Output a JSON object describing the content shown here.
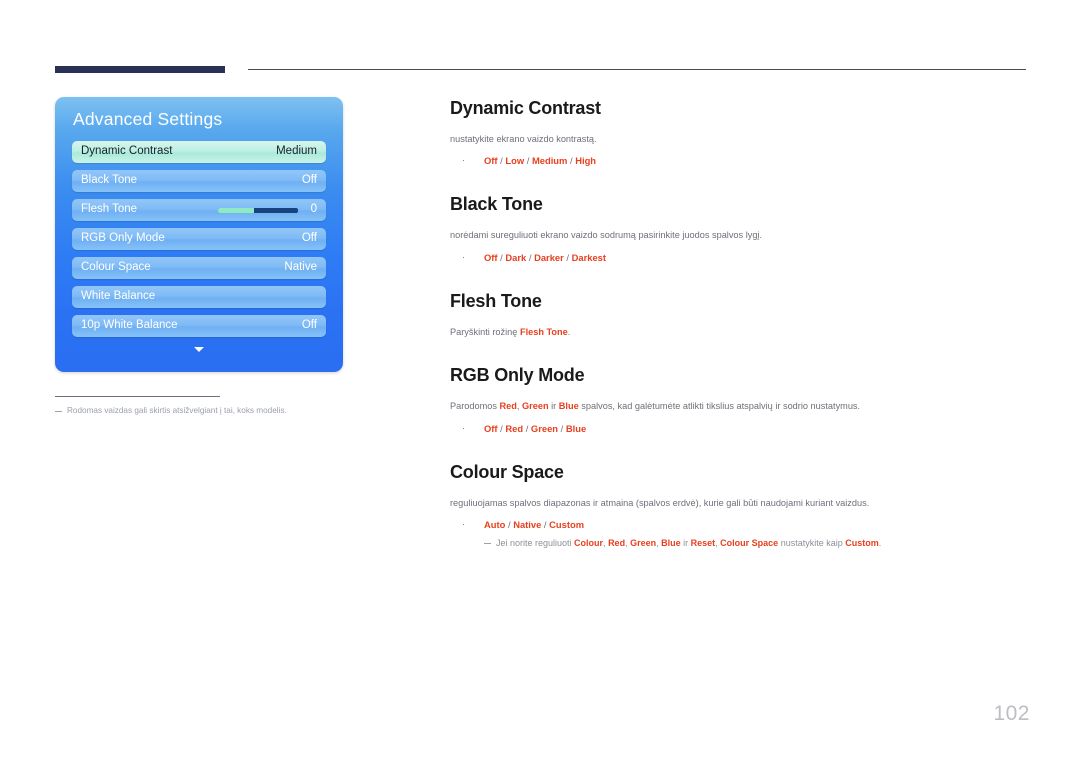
{
  "page": {
    "number": "102"
  },
  "osd": {
    "title": "Advanced Settings",
    "scroll_arrow_icon": "chevron-down-icon",
    "rows": [
      {
        "label": "Dynamic Contrast",
        "value": "Medium",
        "selected": true,
        "type": "value"
      },
      {
        "label": "Black Tone",
        "value": "Off",
        "selected": false,
        "type": "value"
      },
      {
        "label": "Flesh Tone",
        "value": "0",
        "selected": false,
        "type": "slider",
        "slider_percent": 45
      },
      {
        "label": "RGB Only Mode",
        "value": "Off",
        "selected": false,
        "type": "value"
      },
      {
        "label": "Colour Space",
        "value": "Native",
        "selected": false,
        "type": "value"
      },
      {
        "label": "White Balance",
        "value": "",
        "selected": false,
        "type": "value"
      },
      {
        "label": "10p White Balance",
        "value": "Off",
        "selected": false,
        "type": "value"
      }
    ]
  },
  "panel_footnote": {
    "text": "Rodomas vaizdas gali skirtis atsižvelgiant į tai, koks modelis."
  },
  "sections": {
    "dynamic_contrast": {
      "heading": "Dynamic Contrast",
      "desc": "nustatykite ekrano vaizdo kontrastą.",
      "bullet": "Off / Low / Medium / High"
    },
    "black_tone": {
      "heading": "Black Tone",
      "desc": "norėdami sureguliuoti ekrano vaizdo sodrumą pasirinkite juodos spalvos lygį.",
      "bullet": "Off / Dark / Darker / Darkest"
    },
    "flesh_tone": {
      "heading": "Flesh Tone",
      "desc_pre": "Paryškinti rožinę ",
      "desc_accent": "Flesh Tone",
      "desc_post": "."
    },
    "rgb_only_mode": {
      "heading": "RGB Only Mode",
      "desc_p1": "Parodomos ",
      "desc_a1": "Red",
      "desc_p2": ", ",
      "desc_a2": "Green",
      "desc_p3": " ir ",
      "desc_a3": "Blue",
      "desc_p4": " spalvos, kad galėtumėte atlikti tikslius atspalvių ir sodrio nustatymus.",
      "bullet": "Off / Red / Green / Blue"
    },
    "colour_space": {
      "heading": "Colour Space",
      "desc": "reguliuojamas spalvos diapazonas ir atmaina (spalvos erdvė), kurie gali būti naudojami kuriant vaizdus.",
      "bullet": "Auto / Native / Custom",
      "note_p1": "Jei norite reguliuoti ",
      "note_a1": "Colour",
      "note_p2": ", ",
      "note_a2": "Red",
      "note_p3": ", ",
      "note_a3": "Green",
      "note_p4": ", ",
      "note_a4": "Blue",
      "note_p5": " ir ",
      "note_a5": "Reset",
      "note_p6": ", ",
      "note_a6": "Colour Space",
      "note_p7": " nustatykite kaip ",
      "note_a7": "Custom",
      "note_p8": "."
    }
  },
  "colors": {
    "accent_red": "#e8401f",
    "header_bar": "#2b3154",
    "osd_blue": "#2f7ef4",
    "osd_selected": "#bdf0e2",
    "body_text": "#6d7078",
    "page_number": "#bcbec4"
  }
}
